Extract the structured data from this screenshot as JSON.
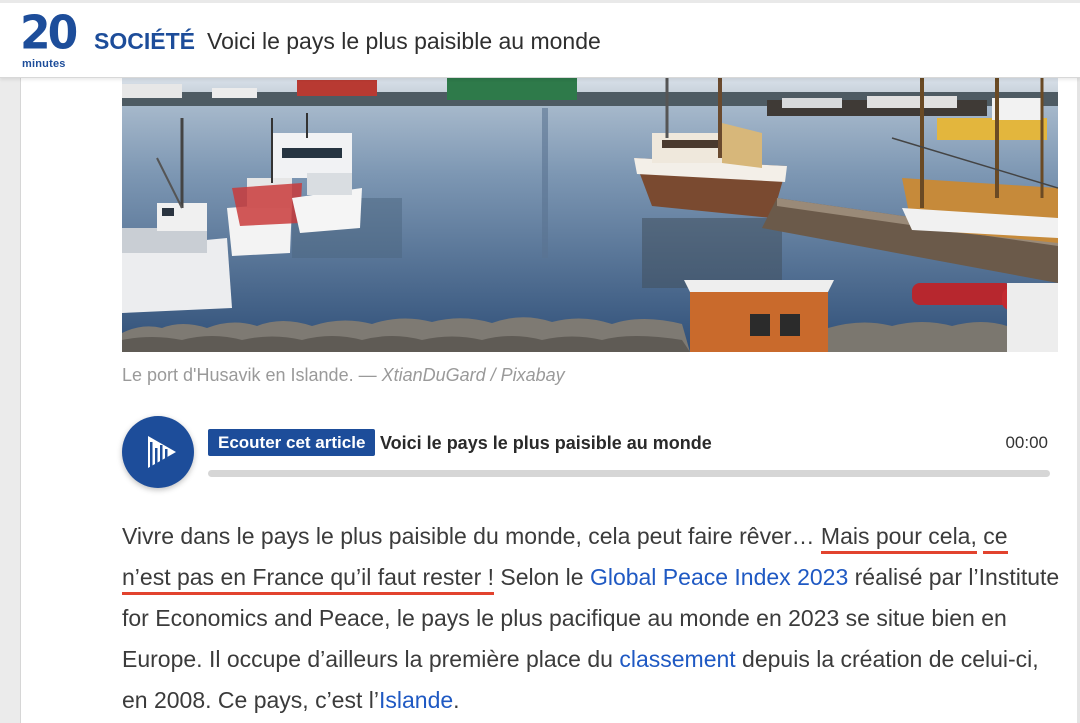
{
  "header": {
    "logo_digits": "20",
    "logo_word": "minutes",
    "section": "SOCIÉTÉ",
    "title": "Voici le pays le plus paisible au monde"
  },
  "photo": {
    "caption": "Le port d'Husavik en Islande. — ",
    "credit": "XtianDuGard / Pixabay"
  },
  "player": {
    "badge": "Ecouter cet article",
    "title": "Voici le pays le plus paisible au monde",
    "time": "00:00",
    "progress_fraction": 0
  },
  "article": {
    "t1": "Vivre dans le pays le plus paisible du monde, cela peut faire rêver… ",
    "hl1": "Mais pour cela,",
    "t2": " ",
    "hl2": "ce n’est pas en France qu’il faut rester !",
    "t3": " Selon le ",
    "link1": "Global Peace Index 2023",
    "t4": " réalisé par l’Institute for Economics and Peace, le pays le plus pacifique au monde en 2023 se situe bien en Europe. Il occupe d’ailleurs la première place du ",
    "link2": "classement",
    "t5": " depuis la création de celui-ci, en 2008. Ce pays, c’est l’",
    "link3": "Islande",
    "t6": "."
  },
  "colors": {
    "brand": "#1d4d9a",
    "link": "#1f59c3",
    "highlight_underline": "#e2432e"
  }
}
